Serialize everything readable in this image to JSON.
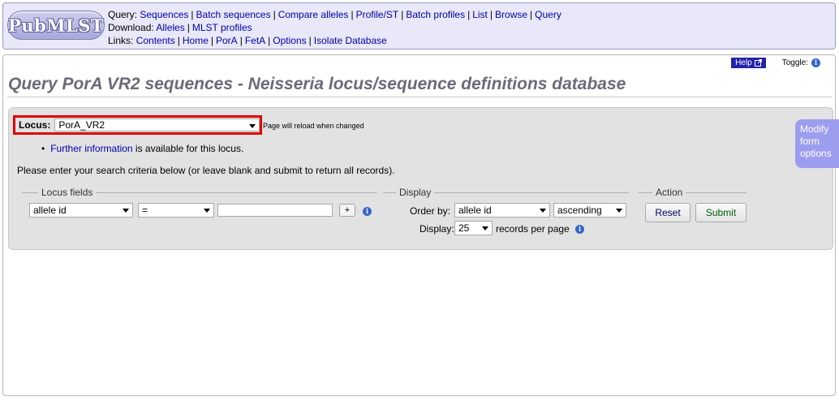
{
  "header": {
    "logo_text": "PubMLST",
    "query_label": "Query:",
    "query_links": [
      "Sequences",
      "Batch sequences",
      "Compare alleles",
      "Profile/ST",
      "Batch profiles",
      "List",
      "Browse",
      "Query"
    ],
    "download_label": "Download:",
    "download_links": [
      "Alleles",
      "MLST profiles"
    ],
    "links_label": "Links:",
    "links": [
      "Contents",
      "Home",
      "PorA",
      "FetA",
      "Options",
      "Isolate Database"
    ]
  },
  "helpbar": {
    "help_label": "Help",
    "toggle_label": "Toggle:"
  },
  "page_title": "Query PorA VR2 sequences - Neisseria locus/sequence definitions database",
  "form": {
    "locus_label": "Locus:",
    "locus_value": "PorA_VR2",
    "reload_note": "Page will reload when changed",
    "further_link": "Further information",
    "further_text": " is available for this locus.",
    "instructions": "Please enter your search criteria below (or leave blank and submit to return all records).",
    "locus_fields_legend": "Locus fields",
    "field_value": "allele id",
    "operator_value": "=",
    "plus_label": "+",
    "display_legend": "Display",
    "order_by_label": "Order by:",
    "order_by_value": "allele id",
    "direction_value": "ascending",
    "display_label": "Display:",
    "display_value": "25",
    "records_label": "records per page",
    "action_legend": "Action",
    "reset_label": "Reset",
    "submit_label": "Submit"
  },
  "modify_tab": [
    "Modify",
    "form",
    "options"
  ],
  "colors": {
    "link": "#0000aa",
    "header_bg": "#e8e8f8",
    "panel_bg": "#e2e2e2",
    "highlight_border": "#e00000",
    "modify_tab_bg": "#9d9df0",
    "title": "#6a6a7a"
  }
}
